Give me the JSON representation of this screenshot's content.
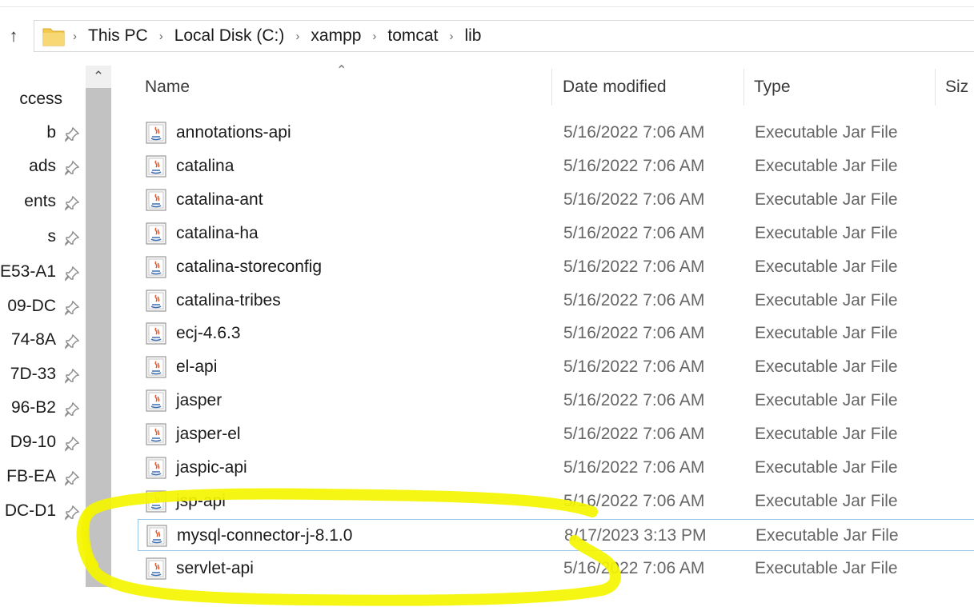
{
  "breadcrumb": [
    "This PC",
    "Local Disk (C:)",
    "xampp",
    "tomcat",
    "lib"
  ],
  "nav_items": [
    {
      "label": "ccess",
      "pinned": false
    },
    {
      "label": "b",
      "pinned": true
    },
    {
      "label": "ads",
      "pinned": true
    },
    {
      "label": "ents",
      "pinned": true
    },
    {
      "label": "s",
      "pinned": true
    },
    {
      "label": "E53-A1",
      "pinned": true
    },
    {
      "label": "09-DC",
      "pinned": true
    },
    {
      "label": "74-8A",
      "pinned": true
    },
    {
      "label": "7D-33",
      "pinned": true
    },
    {
      "label": "96-B2",
      "pinned": true
    },
    {
      "label": "D9-10",
      "pinned": true
    },
    {
      "label": "FB-EA",
      "pinned": true
    },
    {
      "label": "DC-D1",
      "pinned": true
    }
  ],
  "columns": {
    "name": "Name",
    "date": "Date modified",
    "type": "Type",
    "size": "Siz"
  },
  "files": [
    {
      "name": "annotations-api",
      "date": "5/16/2022 7:06 AM",
      "type": "Executable Jar File"
    },
    {
      "name": "catalina",
      "date": "5/16/2022 7:06 AM",
      "type": "Executable Jar File"
    },
    {
      "name": "catalina-ant",
      "date": "5/16/2022 7:06 AM",
      "type": "Executable Jar File"
    },
    {
      "name": "catalina-ha",
      "date": "5/16/2022 7:06 AM",
      "type": "Executable Jar File"
    },
    {
      "name": "catalina-storeconfig",
      "date": "5/16/2022 7:06 AM",
      "type": "Executable Jar File"
    },
    {
      "name": "catalina-tribes",
      "date": "5/16/2022 7:06 AM",
      "type": "Executable Jar File"
    },
    {
      "name": "ecj-4.6.3",
      "date": "5/16/2022 7:06 AM",
      "type": "Executable Jar File"
    },
    {
      "name": "el-api",
      "date": "5/16/2022 7:06 AM",
      "type": "Executable Jar File"
    },
    {
      "name": "jasper",
      "date": "5/16/2022 7:06 AM",
      "type": "Executable Jar File"
    },
    {
      "name": "jasper-el",
      "date": "5/16/2022 7:06 AM",
      "type": "Executable Jar File"
    },
    {
      "name": "jaspic-api",
      "date": "5/16/2022 7:06 AM",
      "type": "Executable Jar File"
    },
    {
      "name": "jsp-api",
      "date": "5/16/2022 7:06 AM",
      "type": "Executable Jar File"
    },
    {
      "name": "mysql-connector-j-8.1.0",
      "date": "8/17/2023 3:13 PM",
      "type": "Executable Jar File",
      "selected": true
    },
    {
      "name": "servlet-api",
      "date": "5/16/2022 7:06 AM",
      "type": "Executable Jar File"
    }
  ],
  "colors": {
    "highlight": "#f5f500",
    "selection_border": "#99c8ec",
    "folder": "#f3c94f"
  },
  "icons": {
    "up": "up-arrow-icon",
    "folder": "folder-icon",
    "jar": "jar-file-icon",
    "pin": "pin-icon"
  }
}
